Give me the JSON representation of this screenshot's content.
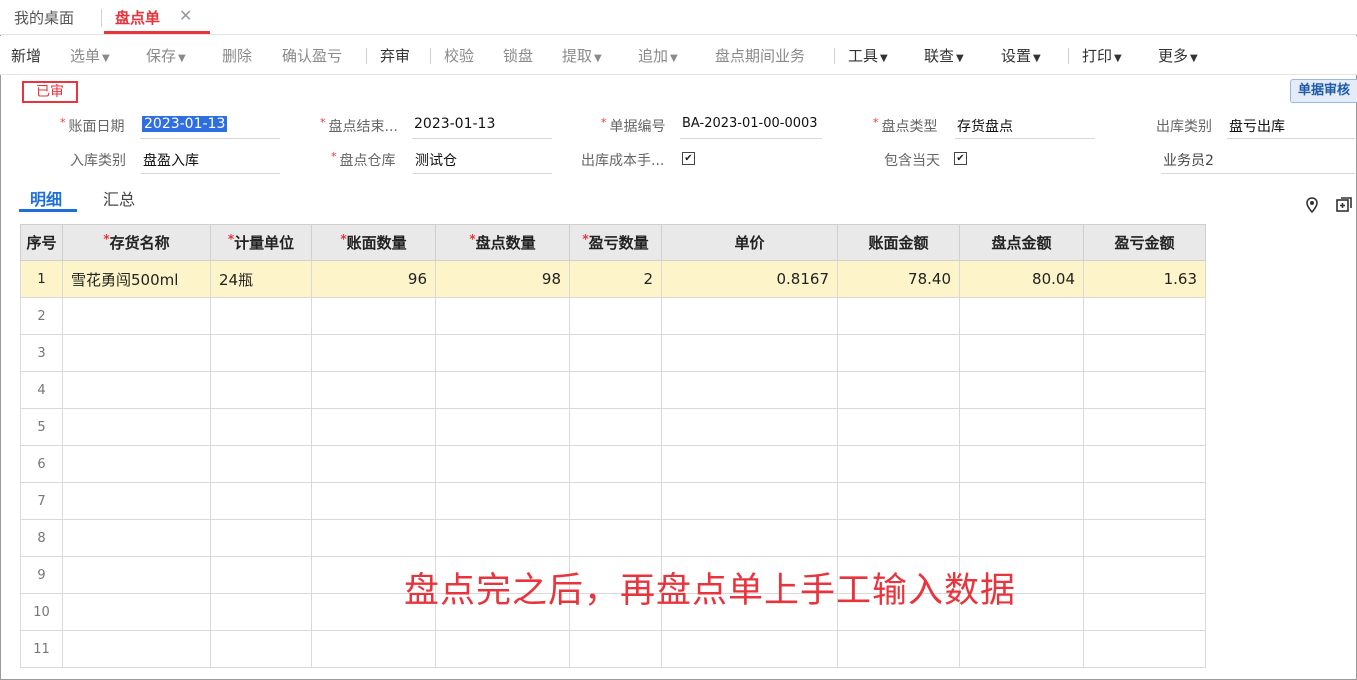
{
  "tabs": {
    "desk": "我的桌面",
    "active": "盘点单",
    "close": "✕"
  },
  "toolbar": {
    "items": [
      "新增",
      "选单",
      "保存",
      "删除",
      "确认盈亏",
      "弃审",
      "校验",
      "锁盘",
      "提取",
      "追加",
      "盘点期间业务",
      "工具",
      "联查",
      "设置",
      "打印",
      "更多"
    ],
    "caret": "⌄"
  },
  "status": {
    "stamp": "已审",
    "audit_button": "单据审核"
  },
  "form": {
    "book_date_label": "账面日期",
    "book_date": "2023-01-13",
    "end_label": "盘点结束...",
    "end_value": "2023-01-13",
    "doc_no_label": "单据编号",
    "doc_no": "BA-2023-01-00-0003",
    "type_label": "盘点类型",
    "type_value": "存货盘点",
    "out_cat_label": "出库类别",
    "out_cat_value": "盘亏出库",
    "in_cat_label": "入库类别",
    "in_cat_value": "盘盈入库",
    "warehouse_label": "盘点仓库",
    "warehouse_value": "测试仓",
    "cost_label": "出库成本手...",
    "include_label": "包含当天",
    "clerk_value": "业务员2"
  },
  "subtabs": {
    "detail": "明细",
    "summary": "汇总"
  },
  "grid": {
    "headers": [
      "序号",
      "存货名称",
      "计量单位",
      "账面数量",
      "盘点数量",
      "盈亏数量",
      "单价",
      "账面金额",
      "盘点金额",
      "盈亏金额"
    ],
    "rows": [
      [
        "1",
        "雪花勇闯500ml",
        "24瓶",
        "96",
        "98",
        "2",
        "0.8167",
        "78.40",
        "80.04",
        "1.63"
      ],
      [
        "2",
        "",
        "",
        "",
        "",
        "",
        "",
        "",
        "",
        ""
      ],
      [
        "3",
        "",
        "",
        "",
        "",
        "",
        "",
        "",
        "",
        ""
      ],
      [
        "4",
        "",
        "",
        "",
        "",
        "",
        "",
        "",
        "",
        ""
      ],
      [
        "5",
        "",
        "",
        "",
        "",
        "",
        "",
        "",
        "",
        ""
      ],
      [
        "6",
        "",
        "",
        "",
        "",
        "",
        "",
        "",
        "",
        ""
      ],
      [
        "7",
        "",
        "",
        "",
        "",
        "",
        "",
        "",
        "",
        ""
      ],
      [
        "8",
        "",
        "",
        "",
        "",
        "",
        "",
        "",
        "",
        ""
      ],
      [
        "9",
        "",
        "",
        "",
        "",
        "",
        "",
        "",
        "",
        ""
      ],
      [
        "10",
        "",
        "",
        "",
        "",
        "",
        "",
        "",
        "",
        ""
      ],
      [
        "11",
        "",
        "",
        "",
        "",
        "",
        "",
        "",
        "",
        ""
      ]
    ]
  },
  "annotation": "盘点完之后，再盘点单上手工输入数据",
  "colors": {
    "accent_red": "#e8343c",
    "link_blue": "#1e6fd9",
    "highlight_row": "#fdf5c9"
  }
}
